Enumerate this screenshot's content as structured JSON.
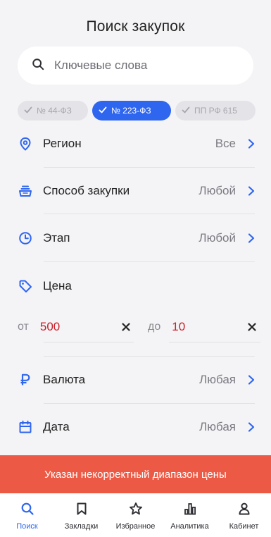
{
  "header": {
    "title": "Поиск закупок"
  },
  "search": {
    "placeholder": "Ключевые слова",
    "icon": "search-icon"
  },
  "law_filters": [
    {
      "label": "№ 44-ФЗ",
      "active": false
    },
    {
      "label": "№ 223-ФЗ",
      "active": true
    },
    {
      "label": "ПП РФ 615",
      "active": false
    }
  ],
  "filters": {
    "region": {
      "label": "Регион",
      "value": "Все",
      "icon": "location-pin-icon"
    },
    "method": {
      "label": "Способ закупки",
      "value": "Любой",
      "icon": "purchase-basket-icon"
    },
    "stage": {
      "label": "Этап",
      "value": "Любой",
      "icon": "clock-icon"
    },
    "price": {
      "label": "Цена",
      "icon": "price-tag-icon",
      "from_prefix": "от",
      "from_value": "500",
      "to_prefix": "до",
      "to_value": "10"
    },
    "currency": {
      "label": "Валюта",
      "value": "Любая",
      "icon": "ruble-icon"
    },
    "date": {
      "label": "Дата",
      "value": "Любая",
      "icon": "calendar-icon"
    }
  },
  "error": {
    "message": "Указан некорректный диапазон цены"
  },
  "tabbar": {
    "items": [
      {
        "label": "Поиск",
        "icon": "search-icon",
        "active": true
      },
      {
        "label": "Закладки",
        "icon": "bookmark-icon",
        "active": false
      },
      {
        "label": "Избранное",
        "icon": "star-icon",
        "active": false
      },
      {
        "label": "Аналитика",
        "icon": "analytics-icon",
        "active": false
      },
      {
        "label": "Кабинет",
        "icon": "person-icon",
        "active": false
      }
    ]
  },
  "colors": {
    "accent": "#2f66f0",
    "error_bg": "#ec5a45",
    "invalid_value": "#c8202a"
  }
}
